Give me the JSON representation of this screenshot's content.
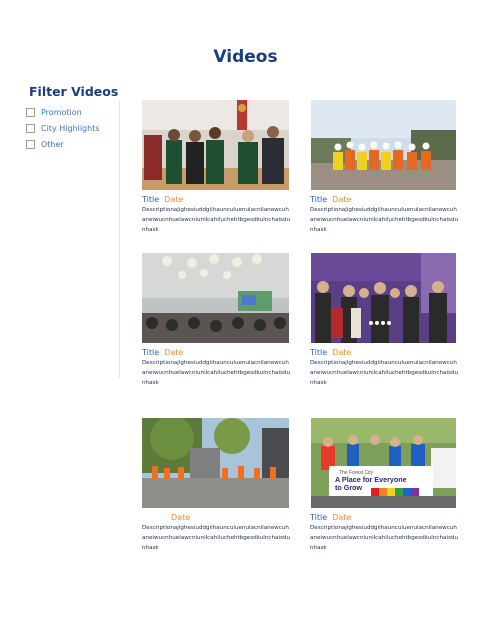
{
  "page": {
    "title": "Videos"
  },
  "filters": {
    "title": "Filter Videos",
    "items": [
      {
        "label": "Promotion",
        "checked": false
      },
      {
        "label": "City Highlights",
        "checked": false
      },
      {
        "label": "Other",
        "checked": false
      }
    ]
  },
  "videos": [
    {
      "title": "Title",
      "date": "Date",
      "description": "Descriptionajighesiuddgiihaunculuenulacnilanewcuhaneiwucnhuelawcniunilcahiluchehtbgesdkulnchaisdunhask",
      "image": "community-center-group-photo"
    },
    {
      "title": "Title",
      "date": "Date",
      "description": "Descriptionajighesiuddgiihaunculuenulacnilanewcuhaneiwucnhuelawcniunilcahiluchehtbgesdkulnchaisdunhask",
      "image": "construction-site-group-photo"
    },
    {
      "title": "Title",
      "date": "Date",
      "description": "Descriptionajighesiuddgiihaunculuenulacnilanewcuhaneiwucnhuelawcniunilcahiluchehtbgesdkulnchaisdunhask",
      "image": "meeting-room-presentation"
    },
    {
      "title": "Title",
      "date": "Date",
      "description": "Descriptionajighesiuddgiihaunculuenulacnilanewcuhaneiwucnhuelawcniunilcahiluchehtbgesdkulnchaisdunhask",
      "image": "ceremony-group-photo"
    },
    {
      "title": "",
      "date": "Date",
      "description": "Descriptionajighesiuddgiihaunculuenulacnilanewcuhaneiwucnhuelawcniunilcahiluchehtbgesdkulnchaisdunhask",
      "image": "outdoor-event-people-in-orange"
    },
    {
      "title": "Title",
      "date": "Date",
      "description": "Descriptionajighesiuddgiihaunculuenulacnilanewcuhaneiwucnhuelawcniunilcahiluchehtbgesdkulnchaisdunhask",
      "image": "pride-parade-banner",
      "banner_text": "The Forest City A Place for Everyone to Grow"
    }
  ],
  "colors": {
    "heading": "#1a3d7c",
    "link": "#3f74c4",
    "title": "#2f63b8",
    "date": "#f28c28"
  }
}
